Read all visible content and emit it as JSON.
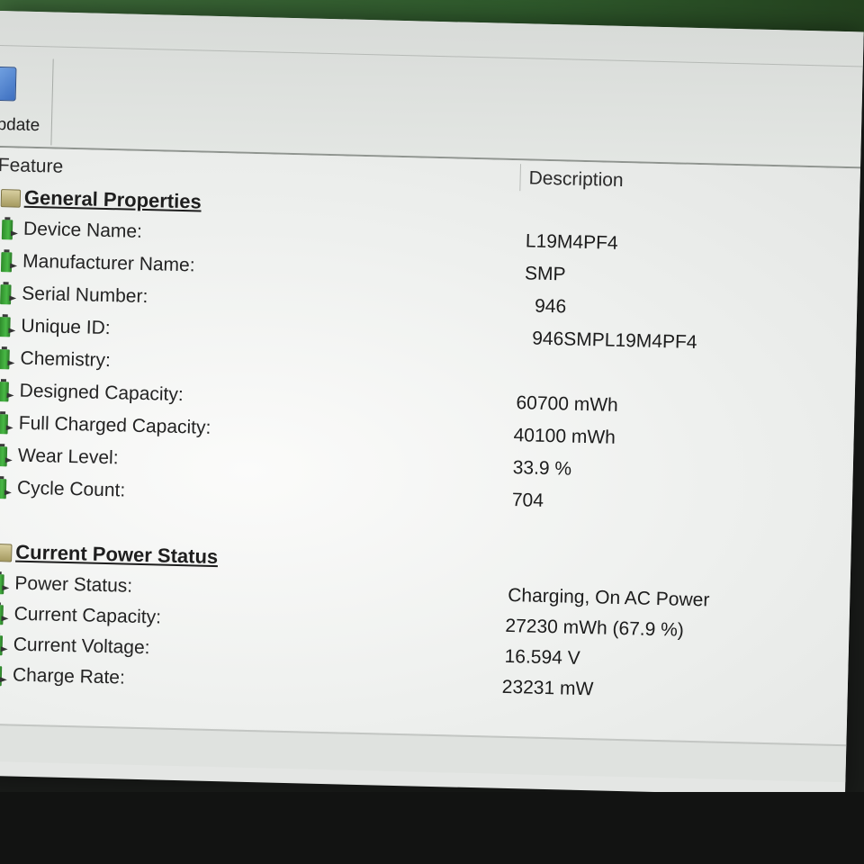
{
  "toolbar": {
    "update_label": "Update",
    "update_icon": "monitor-refresh-icon"
  },
  "table": {
    "col_feature": "Feature",
    "col_description": "Description"
  },
  "general": {
    "title": "General Properties",
    "rows": [
      {
        "label": "Device Name:",
        "value": "L19M4PF4"
      },
      {
        "label": "Manufacturer Name:",
        "value": "SMP"
      },
      {
        "label": "Serial Number:",
        "value": "946"
      },
      {
        "label": "Unique ID:",
        "value": "946SMPL19M4PF4"
      },
      {
        "label": "Chemistry:",
        "value": ""
      },
      {
        "label": "Designed Capacity:",
        "value": "60700 mWh"
      },
      {
        "label": "Full Charged Capacity:",
        "value": "40100 mWh"
      },
      {
        "label": "Wear Level:",
        "value": "33.9 %"
      },
      {
        "label": "Cycle Count:",
        "value": "704"
      }
    ]
  },
  "power": {
    "title": "Current Power Status",
    "rows": [
      {
        "label": "Power Status:",
        "value": "Charging, On AC Power"
      },
      {
        "label": "Current Capacity:",
        "value": "27230 mWh (67.9 %)"
      },
      {
        "label": "Current Voltage:",
        "value": "16.594 V"
      },
      {
        "label": "Charge Rate:",
        "value": "23231 mW"
      }
    ]
  },
  "icons": {
    "group": "battery-group-icon",
    "item": "battery-icon"
  },
  "colors": {
    "battery_green": "#48b845",
    "window_bg": "#e4e6e4"
  }
}
